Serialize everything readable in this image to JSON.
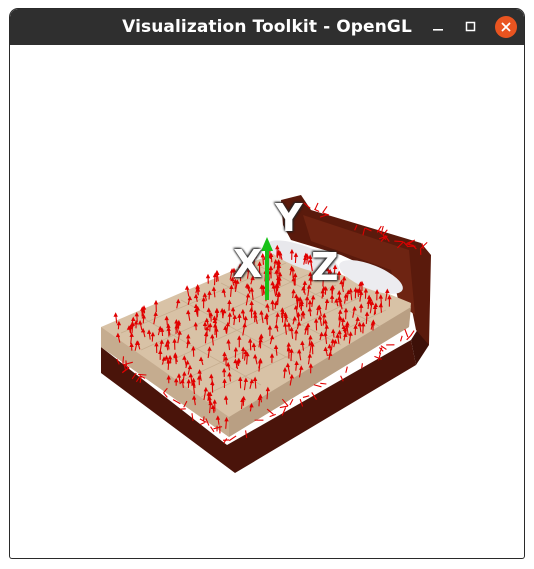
{
  "window": {
    "title": "Visualization Toolkit - OpenGL"
  },
  "controls": {
    "minimize_icon": "minimize-icon",
    "maximize_icon": "maximize-icon",
    "close_icon": "close-icon",
    "close_color": "#e95420"
  },
  "scene": {
    "axes": {
      "x_label": "X",
      "y_label": "Y",
      "z_label": "Z",
      "y_axis_color": "#19c219"
    },
    "normal_arrow_color": "#e00000",
    "bed_frame_color": "#5a1a0c",
    "mattress_color": "#d8c2a6",
    "pillow_color": "#e8e8ec"
  }
}
